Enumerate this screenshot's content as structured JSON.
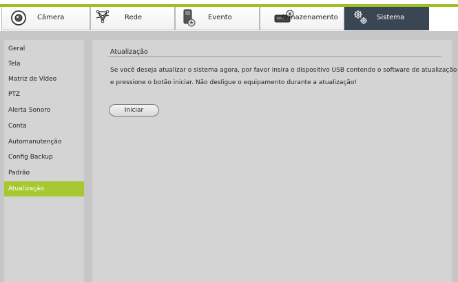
{
  "tabs": [
    {
      "label": "Câmera",
      "icon": "camera-icon",
      "active": false
    },
    {
      "label": "Rede",
      "icon": "network-icon",
      "active": false
    },
    {
      "label": "Evento",
      "icon": "event-icon",
      "active": false
    },
    {
      "label": "Armazenamento",
      "icon": "storage-icon",
      "active": false
    },
    {
      "label": "Sistema",
      "icon": "gears-icon",
      "active": true
    }
  ],
  "sidebar": {
    "items": [
      {
        "label": "Geral"
      },
      {
        "label": "Tela"
      },
      {
        "label": "Matriz de Vídeo"
      },
      {
        "label": "PTZ"
      },
      {
        "label": "Alerta Sonoro"
      },
      {
        "label": "Conta"
      },
      {
        "label": "Automanutenção"
      },
      {
        "label": "Config Backup"
      },
      {
        "label": "Padrão"
      },
      {
        "label": "Atualização",
        "active": true
      }
    ]
  },
  "main": {
    "section_title": "Atualização",
    "message_line1": "Se você deseja atualizar o sistema agora, por favor insira o dispositivo USB contendo o software de atualização",
    "message_line2": "e pressione o botão iniciar. Não desligue o equipamento durante a atualização!",
    "start_label": "Iniciar"
  },
  "colors": {
    "accent_green": "#a8c832",
    "active_tab": "#3b4654",
    "panel_gray": "#d4d4d4"
  }
}
